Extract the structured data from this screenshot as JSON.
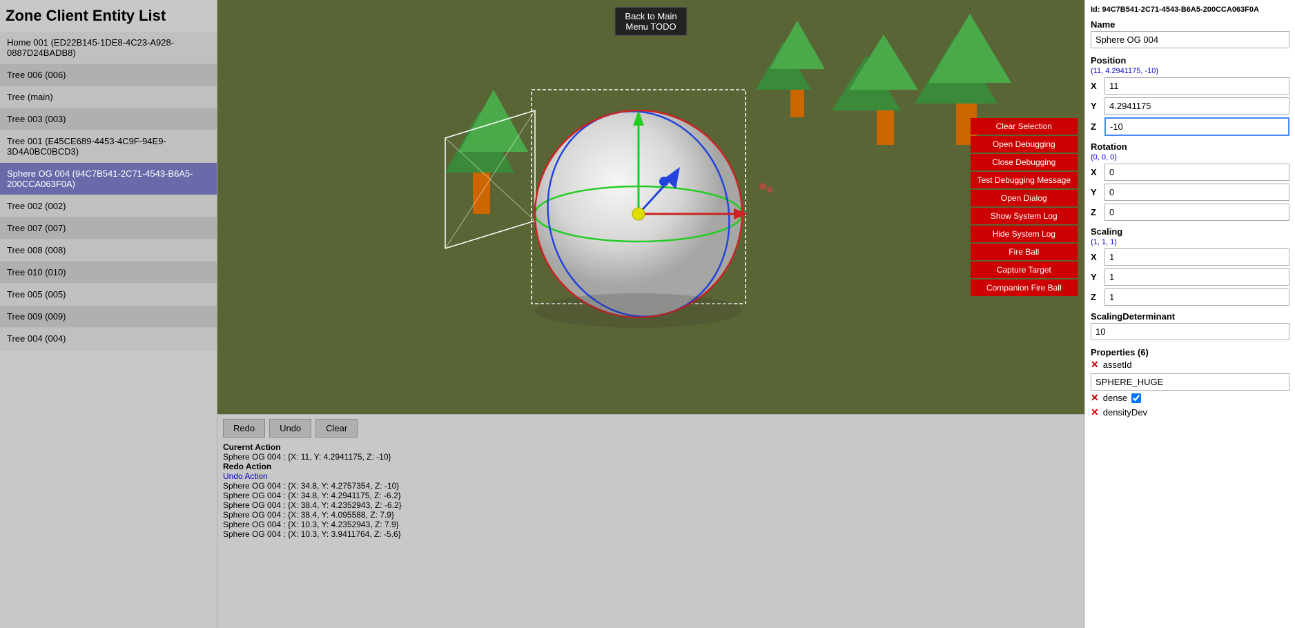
{
  "leftPanel": {
    "title": "Zone Client Entity List",
    "entities": [
      {
        "label": "Home 001 (ED22B145-1DE8-4C23-A928-0887D24BADB8)",
        "selected": false,
        "alt": false
      },
      {
        "label": "Tree 006 (006)",
        "selected": false,
        "alt": true
      },
      {
        "label": "Tree (main)",
        "selected": false,
        "alt": false
      },
      {
        "label": "Tree 003 (003)",
        "selected": false,
        "alt": true
      },
      {
        "label": "Tree 001 (E45CE689-4453-4C9F-94E9-3D4A0BC0BCD3)",
        "selected": false,
        "alt": false
      },
      {
        "label": "Sphere OG 004 (94C7B541-2C71-4543-B6A5-200CCA063F0A)",
        "selected": true,
        "alt": false
      },
      {
        "label": "Tree 002 (002)",
        "selected": false,
        "alt": false
      },
      {
        "label": "Tree 007 (007)",
        "selected": false,
        "alt": true
      },
      {
        "label": "Tree 008 (008)",
        "selected": false,
        "alt": false
      },
      {
        "label": "Tree 010 (010)",
        "selected": false,
        "alt": true
      },
      {
        "label": "Tree 005 (005)",
        "selected": false,
        "alt": false
      },
      {
        "label": "Tree 009 (009)",
        "selected": false,
        "alt": true
      },
      {
        "label": "Tree 004 (004)",
        "selected": false,
        "alt": false
      }
    ]
  },
  "viewport": {
    "backButton": "Back to Main\nMenu TODO"
  },
  "contextMenu": {
    "buttons": [
      "Clear Selection",
      "Open Debugging",
      "Close Debugging",
      "Test Debugging Message",
      "Open Dialog",
      "Show System Log",
      "Hide System Log",
      "Fire Ball",
      "Capture Target",
      "Companion Fire Ball"
    ]
  },
  "actionBar": {
    "buttons": {
      "redo": "Redo",
      "undo": "Undo",
      "clear": "Clear"
    },
    "lines": [
      {
        "type": "header",
        "text": "Curernt Action"
      },
      {
        "type": "normal",
        "text": "Sphere OG 004 : {X: 11, Y: 4.2941175, Z: -10}"
      },
      {
        "type": "header",
        "text": "Redo Action"
      },
      {
        "type": "blue",
        "text": "Undo Action"
      },
      {
        "type": "normal",
        "text": "Sphere OG 004 : {X: 34.8, Y: 4.2757354, Z: -10}"
      },
      {
        "type": "normal",
        "text": "Sphere OG 004 : {X: 34.8, Y: 4.2941175, Z: -6.2}"
      },
      {
        "type": "normal",
        "text": "Sphere OG 004 : {X: 38.4, Y: 4.2352943, Z: -6.2}"
      },
      {
        "type": "normal",
        "text": "Sphere OG 004 : {X: 38.4, Y: 4.095588, Z: 7.9}"
      },
      {
        "type": "normal",
        "text": "Sphere OG 004 : {X: 10.3, Y: 4.2352943, Z: 7.9}"
      },
      {
        "type": "normal",
        "text": "Sphere OG 004 : {X: 10.3, Y: 3.9411764, Z: -5.6}"
      }
    ]
  },
  "rightPanel": {
    "id": "Id: 94C7B541-2C71-4543-B6A5-200CCA063F0A",
    "name": {
      "label": "Name",
      "value": "Sphere OG 004"
    },
    "position": {
      "label": "Position",
      "sublabel": "(11, 4.2941175, -10)",
      "x": "11",
      "y": "4.2941175",
      "z": "-10"
    },
    "rotation": {
      "label": "Rotation",
      "sublabel": "(0, 0, 0)",
      "x": "0",
      "y": "0",
      "z": "0"
    },
    "scaling": {
      "label": "Scaling",
      "sublabel": "(1, 1, 1)",
      "x": "1",
      "y": "1",
      "z": "1"
    },
    "scalingDeterminant": {
      "label": "ScalingDeterminant",
      "value": "10"
    },
    "properties": {
      "label": "Properties (6)",
      "items": [
        {
          "key": "assetId",
          "value": "SPHERE_HUGE",
          "hasCheckbox": false
        },
        {
          "key": "dense",
          "hasCheckbox": true,
          "checked": true
        },
        {
          "key": "densityDev",
          "hasCheckbox": false,
          "value": ""
        }
      ]
    }
  }
}
